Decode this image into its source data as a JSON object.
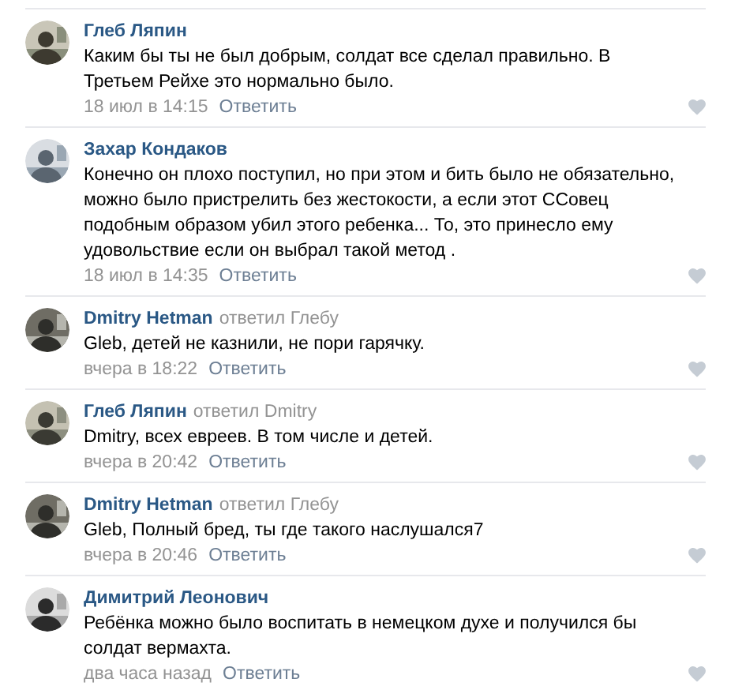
{
  "comments": [
    {
      "author": "Глеб Ляпин",
      "text": "Каким бы ты не был добрым, солдат все сделал правильно. В Третьем Рейхе это нормально было.",
      "date": "18 июл в 14:15",
      "reply_label": "Ответить"
    },
    {
      "author": "Захар Кондаков",
      "text": "Конечно он плохо поступил, но при этом и бить было не обязательно, можно было пристрелить без жестокости, а если этот ССовец подобным образом убил этого ребенка... То, это принесло ему удовольствие если он выбрал такой метод .",
      "date": "18 июл в 14:35",
      "reply_label": "Ответить"
    },
    {
      "author": "Dmitry Hetman",
      "reply_to": "ответил Глебу",
      "text": "Gleb, детей не казнили, не пори гарячку.",
      "date": "вчера в 18:22",
      "reply_label": "Ответить"
    },
    {
      "author": "Глеб Ляпин",
      "reply_to": "ответил Dmitry",
      "text": "Dmitry, всех евреев. В том числе и детей.",
      "date": "вчера в 20:42",
      "reply_label": "Ответить"
    },
    {
      "author": "Dmitry Hetman",
      "reply_to": "ответил Глебу",
      "text": "Gleb, Полный бред, ты где такого наслушался7",
      "date": "вчера в 20:46",
      "reply_label": "Ответить"
    },
    {
      "author": "Димитрий Леонович",
      "text": "Ребёнка можно было воспитать в немецком духе и получился бы солдат вермахта.",
      "date": "два часа назад",
      "reply_label": "Ответить"
    }
  ]
}
